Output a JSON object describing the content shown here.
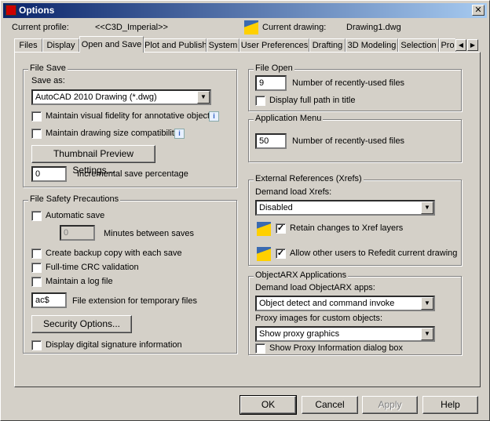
{
  "window": {
    "title": "Options",
    "close": "✕"
  },
  "header": {
    "profile_label": "Current profile:",
    "profile_value": "<<C3D_Imperial>>",
    "drawing_label": "Current drawing:",
    "drawing_value": "Drawing1.dwg"
  },
  "tabs": [
    "Files",
    "Display",
    "Open and Save",
    "Plot and Publish",
    "System",
    "User Preferences",
    "Drafting",
    "3D Modeling",
    "Selection",
    "Pro"
  ],
  "active_tab": "Open and Save",
  "file_save": {
    "title": "File Save",
    "save_as_label": "Save as:",
    "save_as_value": "AutoCAD 2010 Drawing (*.dwg)",
    "visual_fidelity": {
      "label": "Maintain visual fidelity for annotative objects",
      "checked": false
    },
    "size_compat": {
      "label": "Maintain drawing size compatibility",
      "checked": false
    },
    "thumbnail_button": "Thumbnail Preview Settings...",
    "incremental_value": "0",
    "incremental_label": "Incremental save percentage"
  },
  "file_safety": {
    "title": "File Safety Precautions",
    "autosave": {
      "label": "Automatic save",
      "checked": false
    },
    "minutes_value": "0",
    "minutes_label": "Minutes between saves",
    "backup": {
      "label": "Create backup copy with each save",
      "checked": false
    },
    "crc": {
      "label": "Full-time CRC validation",
      "checked": false
    },
    "log": {
      "label": "Maintain a log file",
      "checked": false
    },
    "ext_value": "ac$",
    "ext_label": "File extension for temporary files",
    "security_button": "Security Options...",
    "signature": {
      "label": "Display digital signature information",
      "checked": false
    }
  },
  "file_open": {
    "title": "File Open",
    "recent_value": "9",
    "recent_label": "Number of recently-used files",
    "fullpath": {
      "label": "Display full path in title",
      "checked": false
    }
  },
  "app_menu": {
    "title": "Application Menu",
    "recent_value": "50",
    "recent_label": "Number of recently-used files"
  },
  "xrefs": {
    "title": "External References (Xrefs)",
    "demand_label": "Demand load Xrefs:",
    "demand_value": "Disabled",
    "retain": {
      "label": "Retain changes to Xref layers",
      "checked": true
    },
    "refedit": {
      "label": "Allow other users to Refedit current drawing",
      "checked": true
    }
  },
  "objectarx": {
    "title": "ObjectARX Applications",
    "demand_label": "Demand load ObjectARX apps:",
    "demand_value": "Object detect and command invoke",
    "proxy_label": "Proxy images for custom objects:",
    "proxy_value": "Show proxy graphics",
    "proxy_dialog": {
      "label": "Show Proxy Information dialog box",
      "checked": false
    }
  },
  "buttons": {
    "ok": "OK",
    "cancel": "Cancel",
    "apply": "Apply",
    "help": "Help"
  },
  "icons": {
    "info": "i",
    "arrow_down": "▼",
    "arrow_left": "◀",
    "arrow_right": "▶"
  }
}
